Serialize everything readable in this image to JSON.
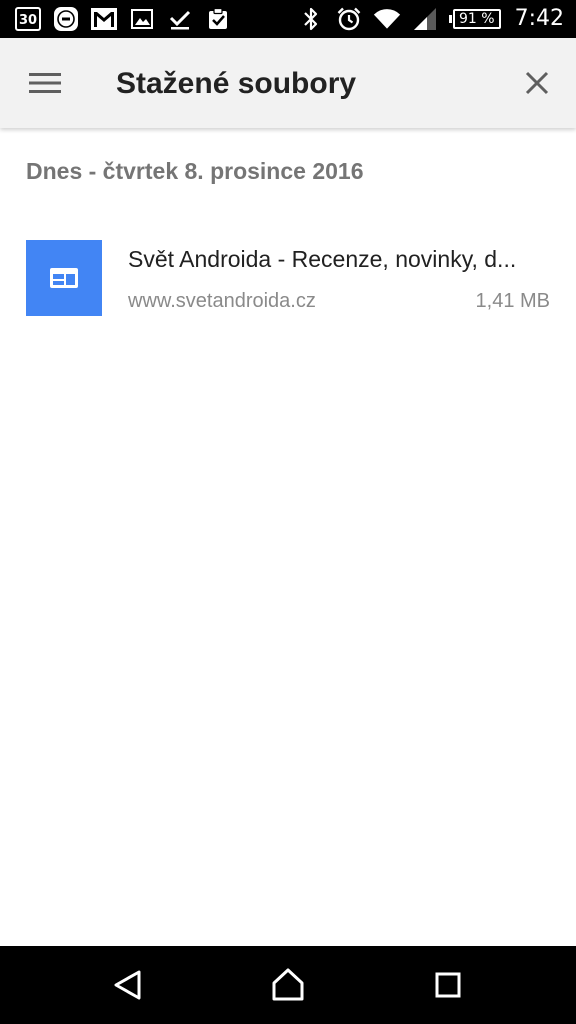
{
  "status_bar": {
    "calendar_day": "30",
    "battery_percent": "91 %",
    "time": "7:42",
    "icons": [
      "calendar-icon",
      "mi-icon",
      "gmail-icon",
      "image-icon",
      "check-icon",
      "clipboard-check-icon",
      "bluetooth-icon",
      "alarm-icon",
      "wifi-icon",
      "signal-icon",
      "battery-icon"
    ]
  },
  "toolbar": {
    "title": "Stažené soubory",
    "menu_icon": "hamburger-menu-icon",
    "close_icon": "close-icon"
  },
  "downloads": {
    "section_header": "Dnes - čtvrtek 8. prosince 2016",
    "items": [
      {
        "title": "Svět Androida - Recenze, novinky, d...",
        "domain": "www.svetandroida.cz",
        "size": "1,41 MB",
        "icon": "web-page-icon",
        "thumb_color": "#4285f4"
      }
    ]
  },
  "nav_bar": {
    "icons": [
      "back-icon",
      "home-icon",
      "recents-icon"
    ]
  },
  "colors": {
    "toolbar_bg": "#f2f2f2",
    "status_bar_bg": "#000000",
    "accent": "#4285f4"
  }
}
